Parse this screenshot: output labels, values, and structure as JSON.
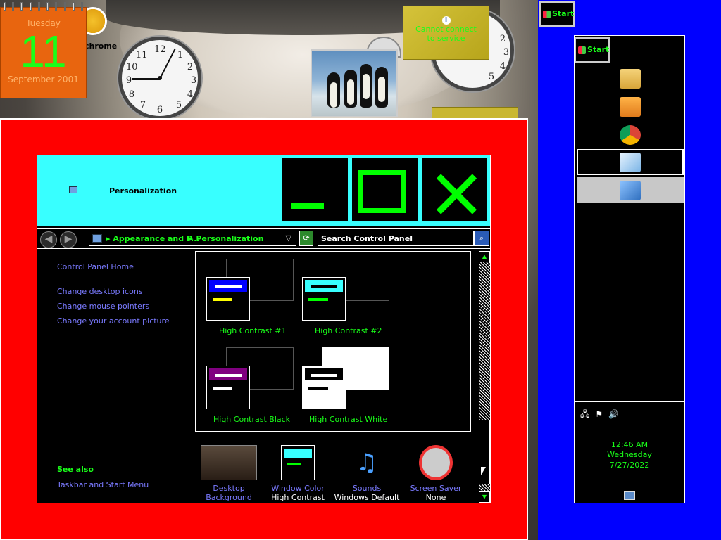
{
  "desktop": {
    "calendar": {
      "day_of_week": "Tuesday",
      "day": "11",
      "month_year": "September 2001"
    },
    "chrome_label": "chrome",
    "weather": {
      "message_line1": "Cannot connect",
      "message_line2": "to service",
      "info_glyph": "i"
    }
  },
  "window": {
    "title": "Personalization",
    "nav": {
      "back_glyph": "◀",
      "forward_glyph": "▶",
      "crumb1": "▸ Appearance and P...",
      "crumb2": "▸ Personalization",
      "dropdown_glyph": "▽",
      "refresh_glyph": "⟳",
      "search_placeholder": "Search Control Panel",
      "search_glyph": "⌕"
    },
    "left_links": {
      "home": "Control Panel Home",
      "desktop_icons": "Change desktop icons",
      "mouse_pointers": "Change mouse pointers",
      "account_picture": "Change your account picture",
      "see_also": "See also",
      "taskbar": "Taskbar and Start Menu"
    },
    "themes": [
      {
        "name": "High Contrast #1",
        "bar_color": "#0000ff",
        "line_color": "#ffff00"
      },
      {
        "name": "High Contrast #2",
        "bar_color": "#38ffff",
        "line_color": "#00ff00"
      },
      {
        "name": "High Contrast Black",
        "bar_color": "#800080",
        "line_color": "#ffffff"
      },
      {
        "name": "High Contrast White",
        "bar_color": "#000000",
        "line_color": "#000000"
      }
    ],
    "bottom": [
      {
        "label1": "Desktop",
        "label2": "Background",
        "sub": ""
      },
      {
        "label1": "Window Color",
        "label2": "",
        "sub": "High Contrast"
      },
      {
        "label1": "Sounds",
        "label2": "",
        "sub": "Windows Default"
      },
      {
        "label1": "Screen Saver",
        "label2": "",
        "sub": "None"
      }
    ],
    "scroll": {
      "up": "▲",
      "down": "▼"
    }
  },
  "taskbar": {
    "start_label": "Start",
    "items": [
      "file-explorer-icon",
      "media-player-icon",
      "chrome-icon",
      "notepad-icon",
      "control-panel-icon"
    ],
    "tray_icons": "🖧⚑🔊",
    "time": "12:46 AM",
    "day": "Wednesday",
    "date": "7/27/2022"
  },
  "colors": {
    "accent_green": "#19ff19",
    "blue_side": "#0000ff",
    "red_frame": "#ff0000",
    "title_cyan": "#38ffff"
  }
}
